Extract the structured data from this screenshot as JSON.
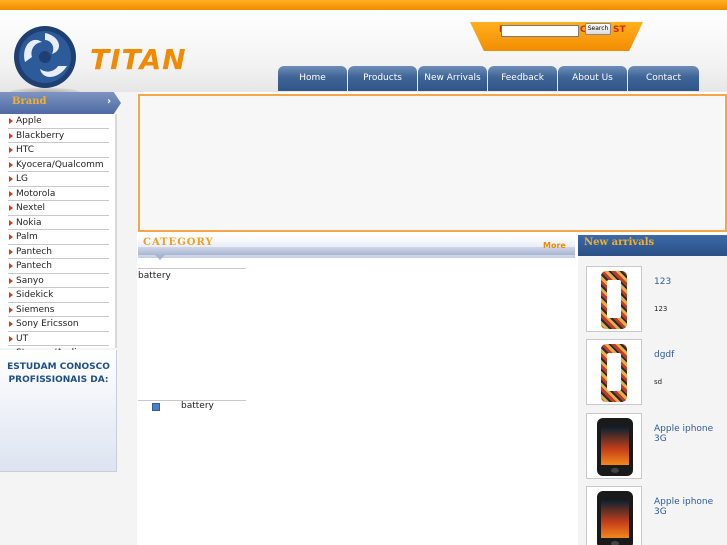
{
  "header": {
    "logo_text": "TITAN",
    "search": {
      "partial_left": "I",
      "partial_right": "IC",
      "partial_tail": "ST",
      "placeholder": "",
      "value": "",
      "button_label": "Search"
    },
    "nav": [
      "Home",
      "Products",
      "New Arrivals",
      "Feedback",
      "About Us",
      "Contact"
    ]
  },
  "sidebar": {
    "title": "Brand",
    "items": [
      "Apple",
      "Blackberry",
      "HTC",
      "Kyocera/Qualcomm",
      "LG",
      "Motorola",
      "Nextel",
      "Nokia",
      "Palm",
      "Pantech",
      "Pantech",
      "Sanyo",
      "Sidekick",
      "Siemens",
      "Sony Ericsson",
      "UT Starcom/Audiovox"
    ],
    "promo_line1": "ESTUDAM CONOSCO",
    "promo_line2": "PROFISSIONAIS DA:"
  },
  "category": {
    "title": "CATEGORY",
    "more": "More",
    "box_label": "battery",
    "item_label": "battery"
  },
  "arrivals": {
    "title": "New arrivals",
    "items": [
      {
        "name": "123",
        "desc": "123"
      },
      {
        "name": "dgdf",
        "desc": "sd"
      },
      {
        "name": "Apple iphone 3G",
        "desc": ""
      },
      {
        "name": "Apple iphone 3G",
        "desc": ""
      }
    ]
  },
  "colors": {
    "accent": "#f08a00",
    "nav_blue": "#3f6496",
    "link_blue": "#2e5a99"
  }
}
